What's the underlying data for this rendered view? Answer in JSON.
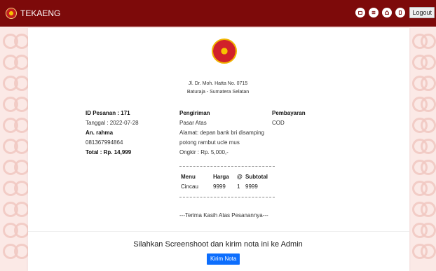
{
  "brand": {
    "name": "TEKAENG"
  },
  "nav": {
    "logout_label": "Logout"
  },
  "receipt": {
    "address_line1": "Jl. Dr. Moh. Hatta No. 0715",
    "address_line2": "Baturaja - Sumatera Selatan",
    "order_id": "ID Pesanan : 171",
    "date": "Tanggal : 2022-07-28",
    "customer_name": "An. rahma",
    "phone": "081367994864",
    "total": "Total : Rp. 14,999",
    "shipping_title": "Pengiriman",
    "shipping_area": "Pasar Atas",
    "shipping_address": "Alamat: depan bank bri disamping potong rambut ucle mus",
    "shipping_cost": "Ongkir : Rp. 5,000,-",
    "payment_title": "Pembayaran",
    "payment_method": "COD",
    "table_headers": [
      "Menu",
      "Harga",
      "@",
      "Subtotal"
    ],
    "items": [
      {
        "menu": "Cincau",
        "price": "9999",
        "qty": "1",
        "subtotal": "9999"
      }
    ],
    "thanks": "---Terima Kasih Atas Pesanannya---"
  },
  "cta": {
    "message": "Silahkan Screenshoot dan kirim nota ini ke Admin",
    "button_label": "Kirim Nota"
  },
  "colors": {
    "navbar": "#7d0a0a",
    "button": "#0d6efd"
  }
}
